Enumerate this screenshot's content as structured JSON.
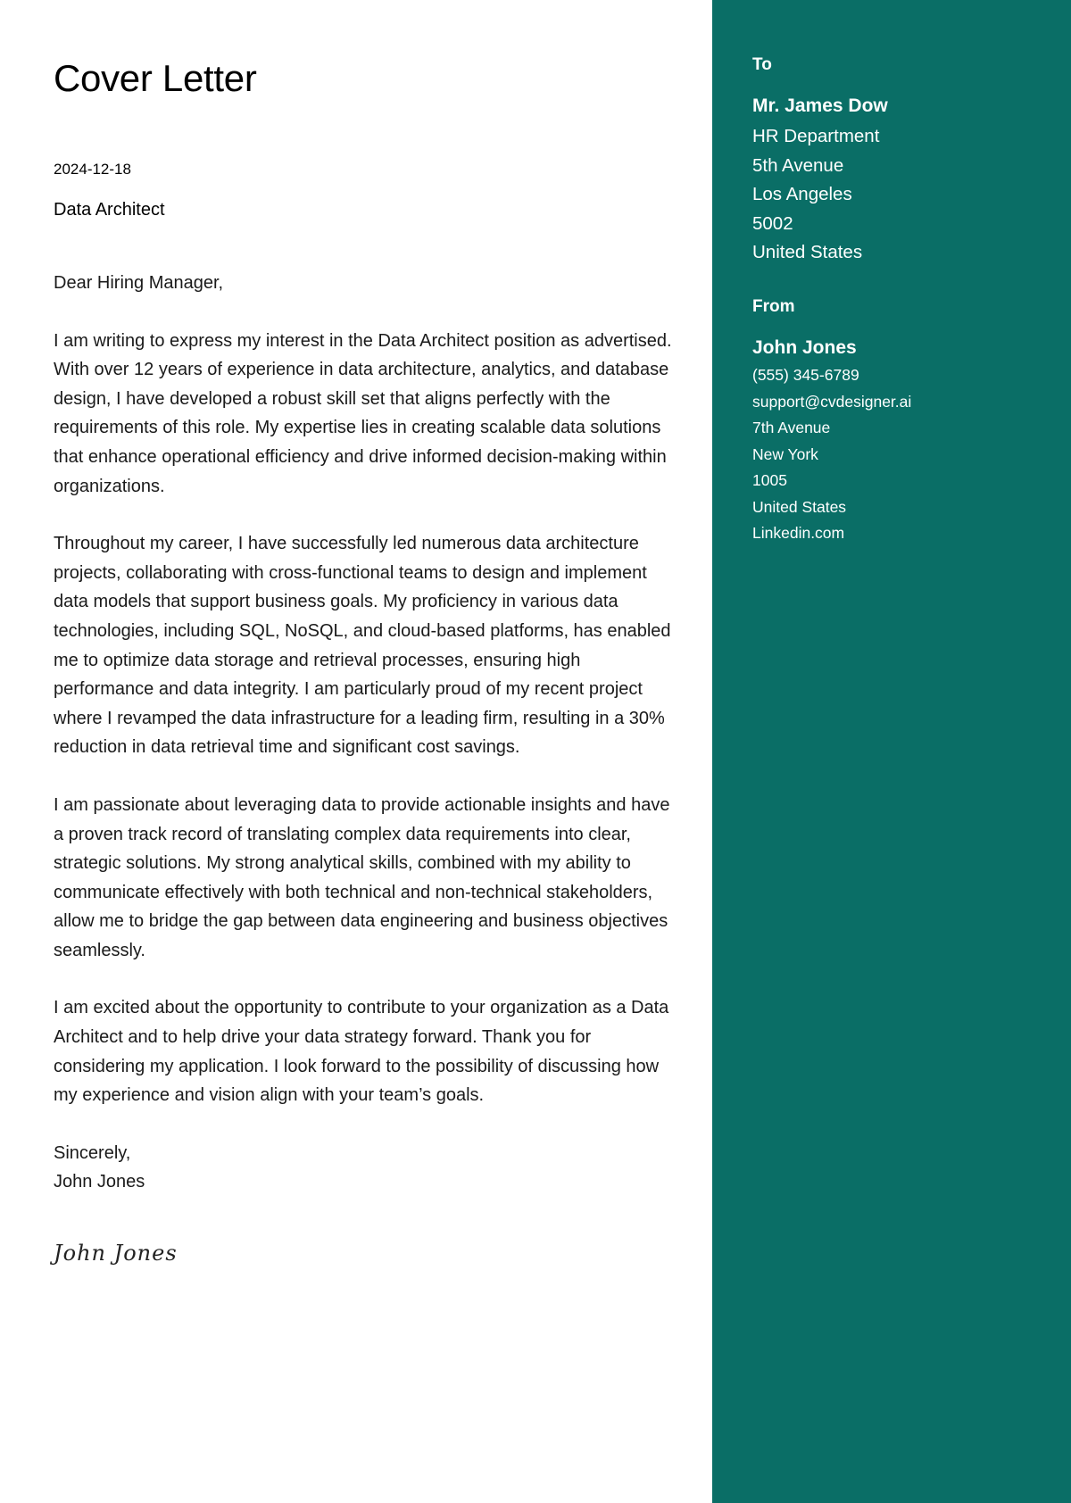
{
  "document": {
    "title": "Cover Letter",
    "date": "2024-12-18",
    "role": "Data Architect"
  },
  "letter": {
    "salutation": "Dear Hiring Manager,",
    "paragraphs": [
      "I am writing to express my interest in the Data Architect position as advertised. With over 12 years of experience in data architecture, analytics, and database design, I have developed a robust skill set that aligns perfectly with the requirements of this role. My expertise lies in creating scalable data solutions that enhance operational efficiency and drive informed decision-making within organizations.",
      "Throughout my career, I have successfully led numerous data architecture projects, collaborating with cross-functional teams to design and implement data models that support business goals. My proficiency in various data technologies, including SQL, NoSQL, and cloud-based platforms, has enabled me to optimize data storage and retrieval processes, ensuring high performance and data integrity. I am particularly proud of my recent project where I revamped the data infrastructure for a leading firm, resulting in a 30% reduction in data retrieval time and significant cost savings.",
      "I am passionate about leveraging data to provide actionable insights and have a proven track record of translating complex data requirements into clear, strategic solutions. My strong analytical skills, combined with my ability to communicate effectively with both technical and non-technical stakeholders, allow me to bridge the gap between data engineering and business objectives seamlessly.",
      "I am excited about the opportunity to contribute to your organization as a Data Architect and to help drive your data strategy forward. Thank you for considering my application. I look forward to the possibility of discussing how my experience and vision align with your team’s goals."
    ],
    "closing": "Sincerely,",
    "closing_name": "John Jones",
    "signature": "John Jones"
  },
  "recipient": {
    "heading": "To",
    "name": "Mr. James Dow",
    "department": "HR Department",
    "street": "5th Avenue",
    "city": "Los Angeles",
    "postal_code": "5002",
    "country": "United States"
  },
  "sender": {
    "heading": "From",
    "name": "John Jones",
    "phone": "(555) 345-6789",
    "email": "support@cvdesigner.ai",
    "street": "7th Avenue",
    "city": "New York",
    "postal_code": "1005",
    "country": "United States",
    "website": "Linkedin.com"
  },
  "colors": {
    "sidebar_background": "#0a6e66",
    "sidebar_text": "#ffffff"
  }
}
